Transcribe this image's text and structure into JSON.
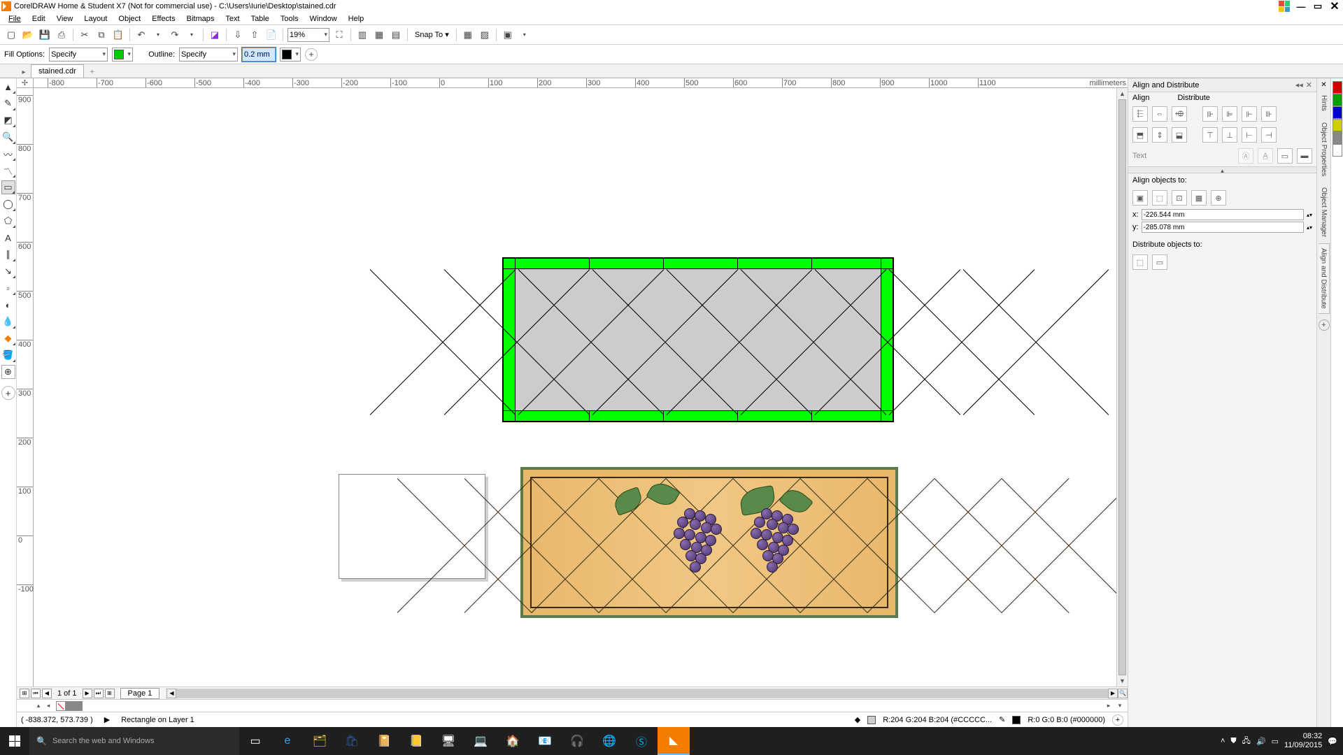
{
  "title": "CorelDRAW Home & Student X7 (Not for commercial use) - C:\\Users\\Iurie\\Desktop\\stained.cdr",
  "menu": [
    "File",
    "Edit",
    "View",
    "Layout",
    "Object",
    "Effects",
    "Bitmaps",
    "Text",
    "Table",
    "Tools",
    "Window",
    "Help"
  ],
  "toolbar": {
    "zoom": "19%",
    "snapto": "Snap To"
  },
  "propbar": {
    "fill_label": "Fill Options:",
    "fill_mode": "Specify",
    "fill_color": "#00cc00",
    "outline_label": "Outline:",
    "outline_mode": "Specify",
    "outline_width": "0.2 mm",
    "outline_color": "#000000"
  },
  "doctab": "stained.cdr",
  "ruler_units": "millimeters",
  "hruler_ticks": [
    "-800",
    "-700",
    "-600",
    "-500",
    "-400",
    "-300",
    "-200",
    "-100",
    "0",
    "100",
    "200",
    "300",
    "400",
    "500",
    "600",
    "700",
    "800",
    "900",
    "1000",
    "1100"
  ],
  "vruler_ticks": [
    "900",
    "800",
    "700",
    "600",
    "500",
    "400",
    "300",
    "200",
    "100",
    "0",
    "-100"
  ],
  "pagenav": {
    "counter": "1 of 1",
    "page": "Page 1"
  },
  "palette": [
    "#000000",
    "#0000ff",
    "#00ffff",
    "#ffffff",
    "#888888",
    "#000000",
    "#ffff00",
    "#ff00ff",
    "#ff8800",
    "#8800ff",
    "#00aa00",
    "#66cc66"
  ],
  "status": {
    "coords": "( -838.372, 573.739 )",
    "object": "Rectangle on Layer 1",
    "fill": "R:204 G:204 B:204 (#CCCCC...",
    "outline": "R:0 G:0 B:0 (#000000)"
  },
  "docker": {
    "title": "Align and Distribute",
    "tab_align": "Align",
    "tab_distribute": "Distribute",
    "text_label": "Text",
    "align_to": "Align objects to:",
    "x": "-226.544 mm",
    "y": "-285.078 mm",
    "distribute_to": "Distribute objects to:"
  },
  "docktabs": [
    "Hints",
    "Object Properties",
    "Object Manager",
    "Align and Distribute"
  ],
  "colorstrip": [
    "#d00000",
    "#00a000",
    "#0000d0",
    "#d0d000",
    "#888888",
    "#ffffff"
  ],
  "taskbar": {
    "search_placeholder": "Search the web and Windows",
    "time": "08:32",
    "date": "11/09/2015"
  }
}
